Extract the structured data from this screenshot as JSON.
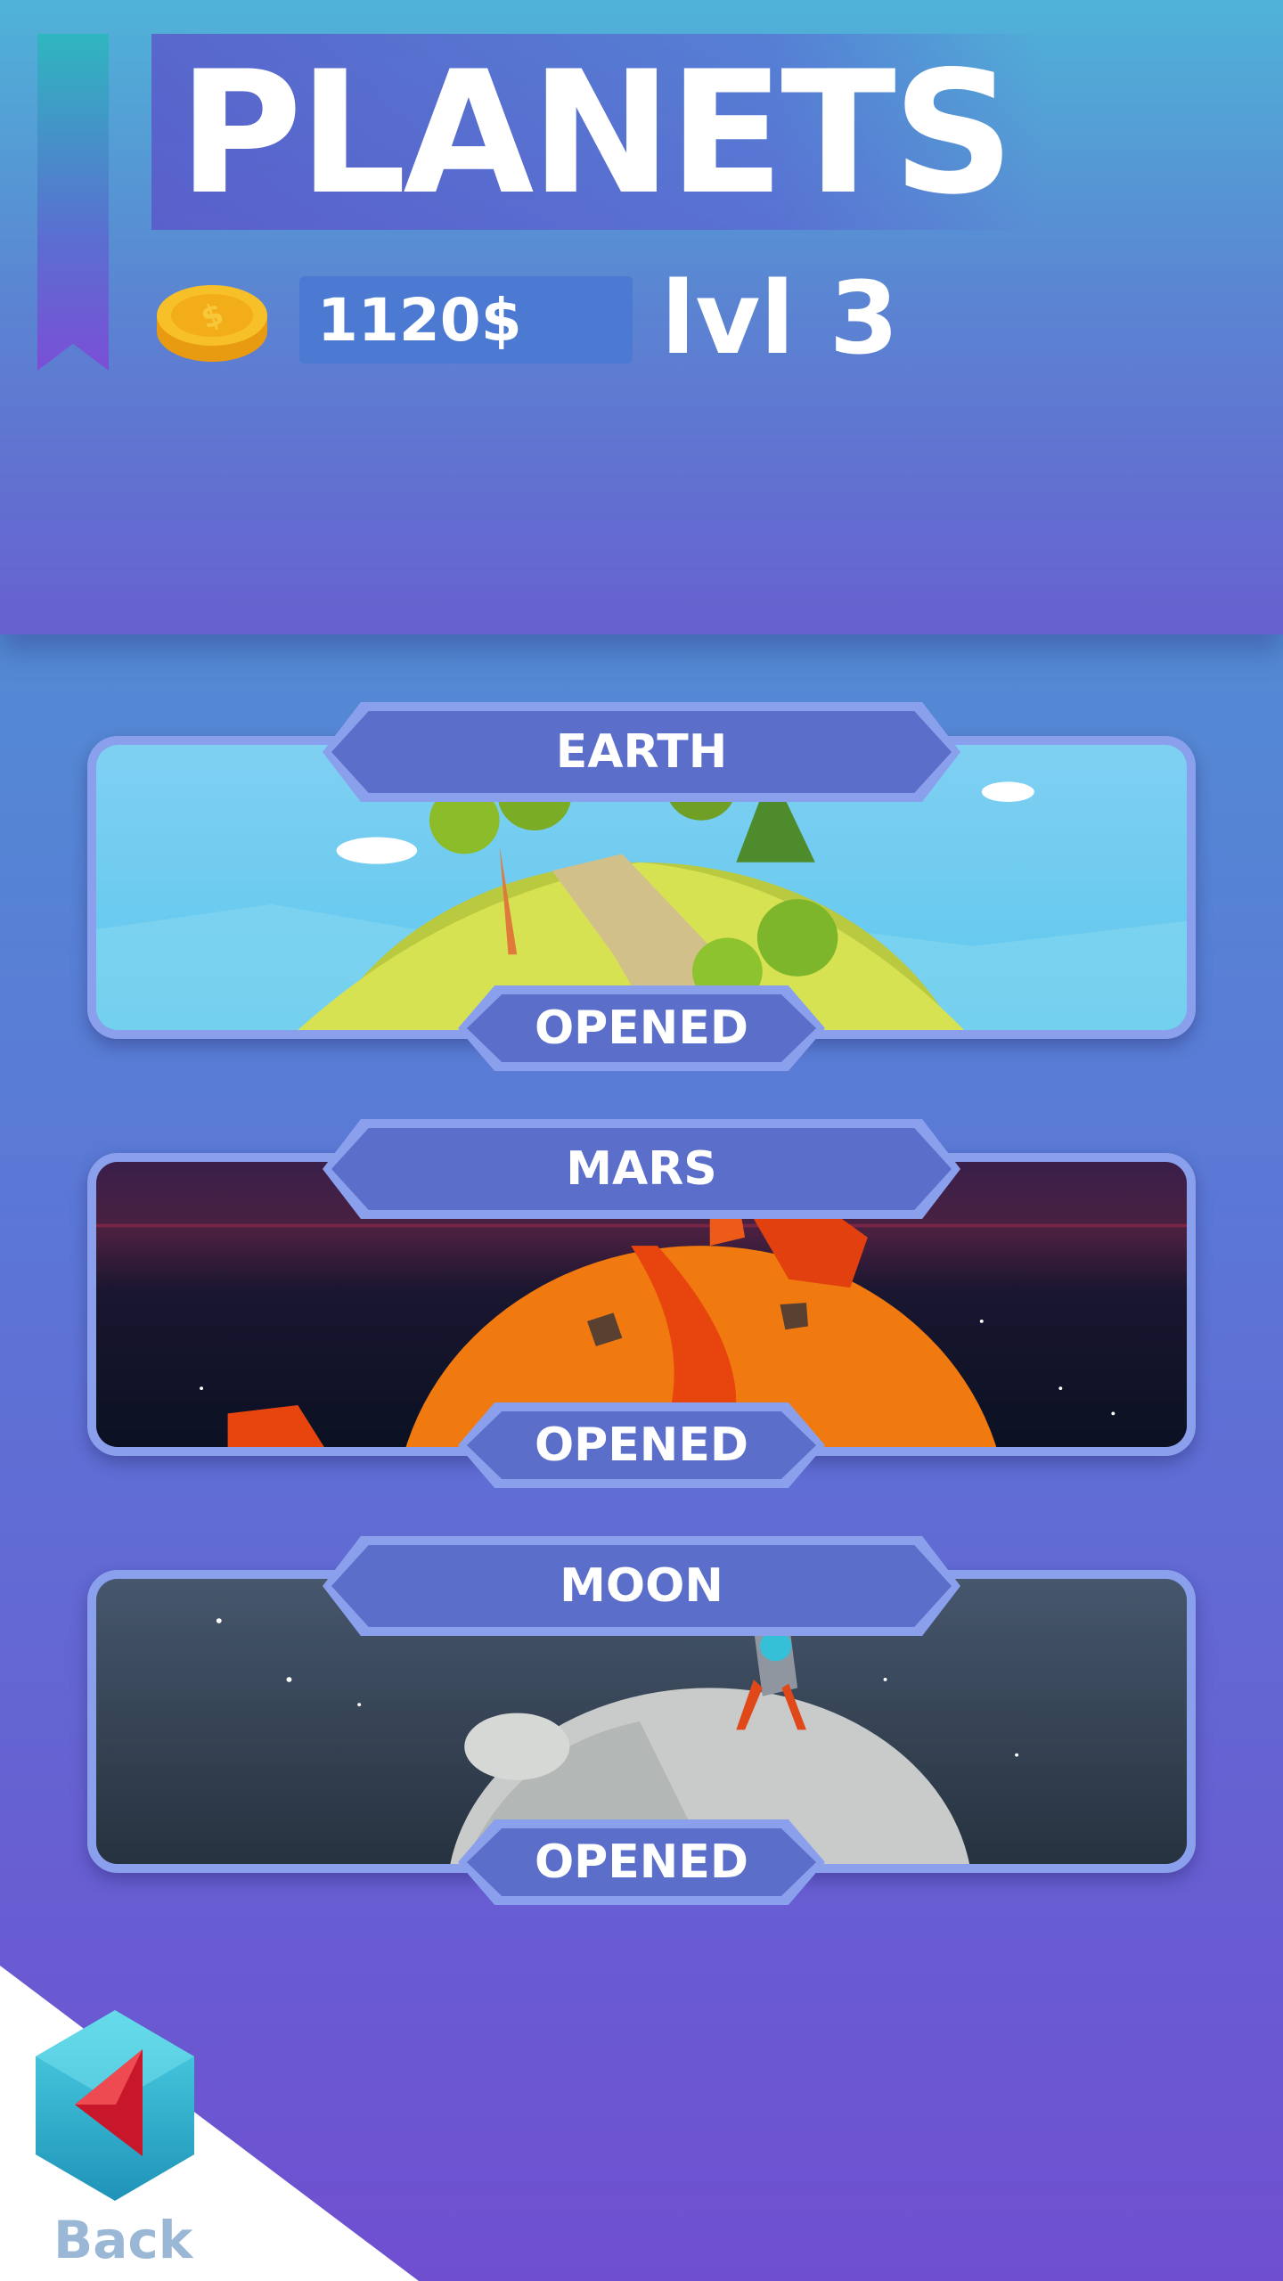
{
  "header": {
    "title": "PLANETS",
    "money": "1120$",
    "level": "lvl 3",
    "coin_icon": "gold-coin-icon"
  },
  "planets": [
    {
      "name": "EARTH",
      "status": "OPENED"
    },
    {
      "name": "MARS",
      "status": "OPENED"
    },
    {
      "name": "MOON",
      "status": "OPENED"
    }
  ],
  "back": {
    "label": "Back",
    "icon": "back-arrow-icon"
  },
  "colors": {
    "tag_fill": "#5b6ec9",
    "tag_border": "#8ba0ec",
    "money_box": "#4c7ad2"
  }
}
